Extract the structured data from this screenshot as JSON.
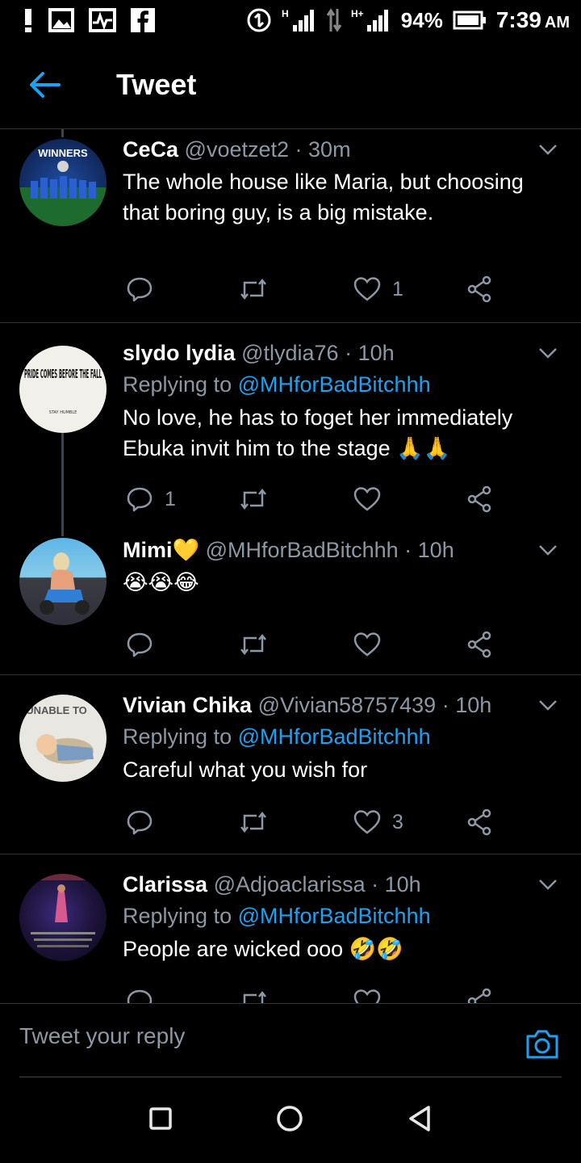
{
  "status_bar": {
    "notification_icons": [
      "exclamation-icon",
      "gallery-icon",
      "activity-icon",
      "facebook-icon"
    ],
    "network_1": "H",
    "network_2": "H+",
    "battery_percent": "94%",
    "time": "7:39",
    "ampm": "AM"
  },
  "header": {
    "title": "Tweet"
  },
  "tweets": [
    {
      "name": "CeCa",
      "handle": "@voetzet2",
      "time": "· 30m",
      "replying_to": "",
      "text": "The whole house like Maria, but choosing that boring guy, is a big mistake.",
      "reply_count": "",
      "retweet_count": "",
      "like_count": "1",
      "avatar_text": "WINNERS"
    },
    {
      "name": "slydo lydia",
      "handle": "@tlydia76",
      "time": "· 10h",
      "replying_prefix": "Replying to ",
      "replying_to": "@MHforBadBitchhh",
      "text": "No love, he has to foget her immediately Ebuka invit him to the stage 🙏🙏",
      "reply_count": "1",
      "retweet_count": "",
      "like_count": "",
      "avatar_text": "PRIDE COMES BEFORE THE FALL",
      "avatar_subtext": "STAY HUMBLE"
    },
    {
      "name": "Mimi💛",
      "handle": "@MHforBadBitchhh",
      "time": "· 10h",
      "replying_to": "",
      "text": "😭😭😂",
      "reply_count": "",
      "retweet_count": "",
      "like_count": ""
    },
    {
      "name": "Vivian Chika",
      "handle": "@Vivian58757439",
      "time": "· 10h",
      "replying_prefix": "Replying to ",
      "replying_to": "@MHforBadBitchhh",
      "text": "Careful what you wish for",
      "reply_count": "",
      "retweet_count": "",
      "like_count": "3",
      "avatar_text": "UNABLE TO"
    },
    {
      "name": "Clarissa",
      "handle": "@Adjoaclarissa",
      "time": "· 10h",
      "replying_prefix": "Replying to ",
      "replying_to": "@MHforBadBitchhh",
      "text": "People are wicked ooo 🤣🤣",
      "reply_count": "",
      "retweet_count": "",
      "like_count": ""
    }
  ],
  "reply_bar": {
    "placeholder": "Tweet your reply"
  },
  "colors": {
    "background": "#000000",
    "accent": "#1da1f2",
    "muted": "#8b98a5",
    "divider": "#2f3336"
  }
}
